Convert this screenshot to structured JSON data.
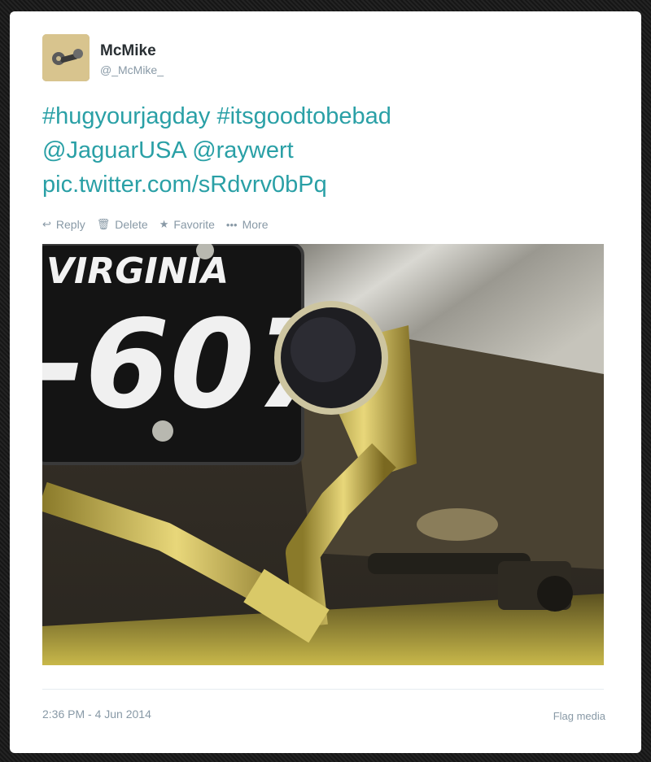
{
  "user": {
    "name": "McMike",
    "handle": "@_McMike_"
  },
  "tweet": {
    "lines": [
      "#hugyourjagday #itsgoodtobebad",
      "@JaguarUSA @raywert",
      "pic.twitter.com/sRdvrv0bPq"
    ]
  },
  "actions": {
    "reply": "Reply",
    "delete": "Delete",
    "favorite": "Favorite",
    "more": "More"
  },
  "media": {
    "plate_state": "VIRGINIA",
    "plate_number": "-607"
  },
  "footer": {
    "timestamp": "2:36 PM - 4 Jun 2014",
    "flag": "Flag media"
  },
  "colors": {
    "link": "#2aa0a6",
    "meta": "#8899a6"
  }
}
